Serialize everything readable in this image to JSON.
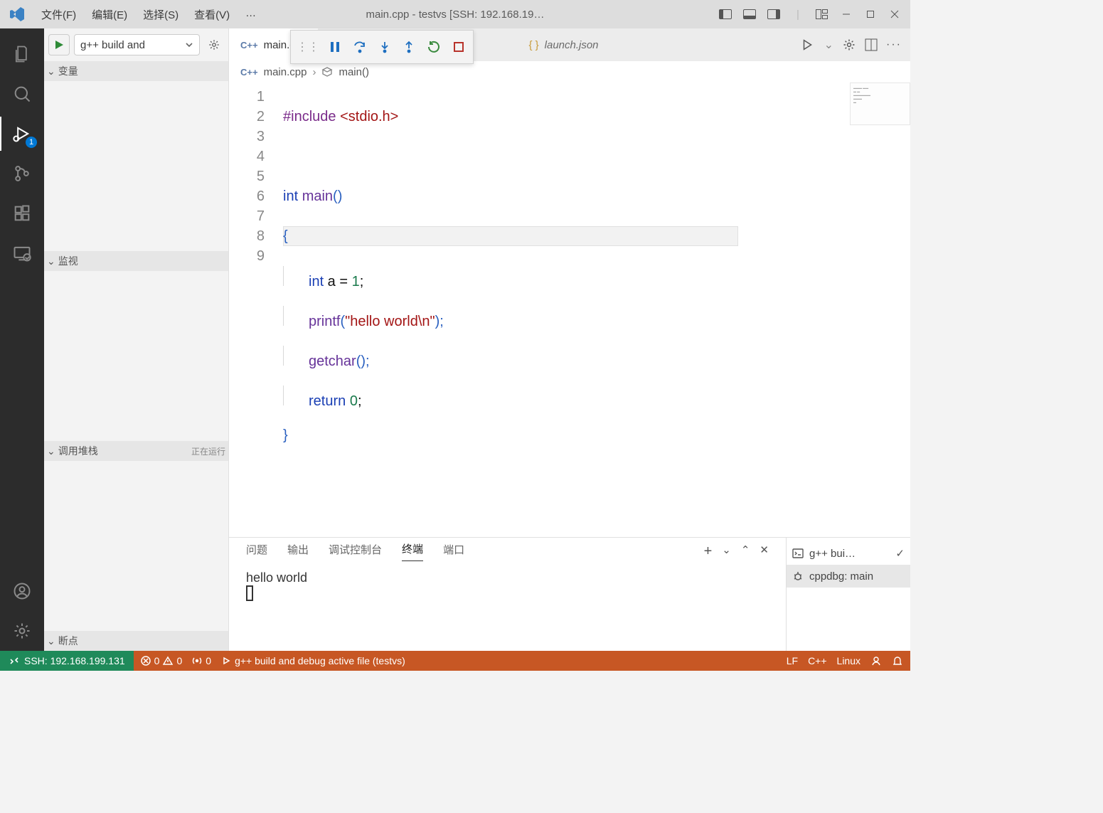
{
  "titlebar": {
    "menus": [
      "文件(F)",
      "编辑(E)",
      "选择(S)",
      "查看(V)",
      "…"
    ],
    "title": "main.cpp - testvs [SSH: 192.168.19…"
  },
  "activity": {
    "debug_badge": "1"
  },
  "sidebar": {
    "config_label": "g++ build and",
    "sections": {
      "variables": "变量",
      "watch": "监视",
      "callstack": "调用堆栈",
      "callstack_status": "正在运行",
      "breakpoints": "断点"
    }
  },
  "tabs": {
    "active": "main.cpp",
    "inactive": "launch.json"
  },
  "breadcrumb": {
    "file": "main.cpp",
    "symbol": "main()"
  },
  "code": {
    "lines": [
      "1",
      "2",
      "3",
      "4",
      "5",
      "6",
      "7",
      "8",
      "9"
    ],
    "l1_macro": "#include",
    "l1_hdr": "<stdio.h>",
    "l3_kw": "int",
    "l3_fn": "main",
    "l3_rest": "()",
    "l4": "{",
    "l5_kw": "int",
    "l5_rest": " a = ",
    "l5_num": "1",
    "l5_semi": ";",
    "l6_fn": "printf",
    "l6_open": "(",
    "l6_str": "\"hello world\\n\"",
    "l6_close": ");",
    "l7_fn": "getchar",
    "l7_rest": "();",
    "l8_kw": "return",
    "l8_num": "0",
    "l8_semi": ";",
    "l9": "}"
  },
  "panel": {
    "tabs": {
      "problems": "问题",
      "output": "输出",
      "debugconsole": "调试控制台",
      "terminal": "终端",
      "ports": "端口"
    },
    "active": "terminal",
    "output_line": "hello world",
    "tasks": {
      "build": "g++ bui…",
      "cppdbg": "cppdbg: main"
    }
  },
  "status": {
    "ssh": "SSH: 192.168.199.131",
    "errors": "0",
    "warnings": "0",
    "ports": "0",
    "config": "g++ build and debug active file (testvs)",
    "eol": "LF",
    "lang": "C++",
    "os": "Linux"
  }
}
